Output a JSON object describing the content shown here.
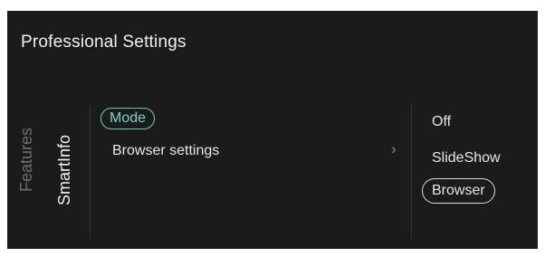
{
  "header": {
    "title": "Professional Settings"
  },
  "nav": {
    "tabs": [
      {
        "label": "Features",
        "active": false
      },
      {
        "label": "SmartInfo",
        "active": true
      }
    ]
  },
  "menu": {
    "items": [
      {
        "label": "Mode",
        "selected": true
      },
      {
        "label": "Browser settings",
        "has_submenu": true
      }
    ],
    "chevron_icon": "chevron-right-icon"
  },
  "options": {
    "items": [
      {
        "label": "Off",
        "selected": false
      },
      {
        "label": "SlideShow",
        "selected": false
      },
      {
        "label": "Browser",
        "selected": true
      }
    ]
  },
  "colors": {
    "background": "#1b1b1b",
    "accent": "#6cc9c2",
    "text": "#e6e6e6",
    "inactive_text": "#6f6f6f"
  }
}
